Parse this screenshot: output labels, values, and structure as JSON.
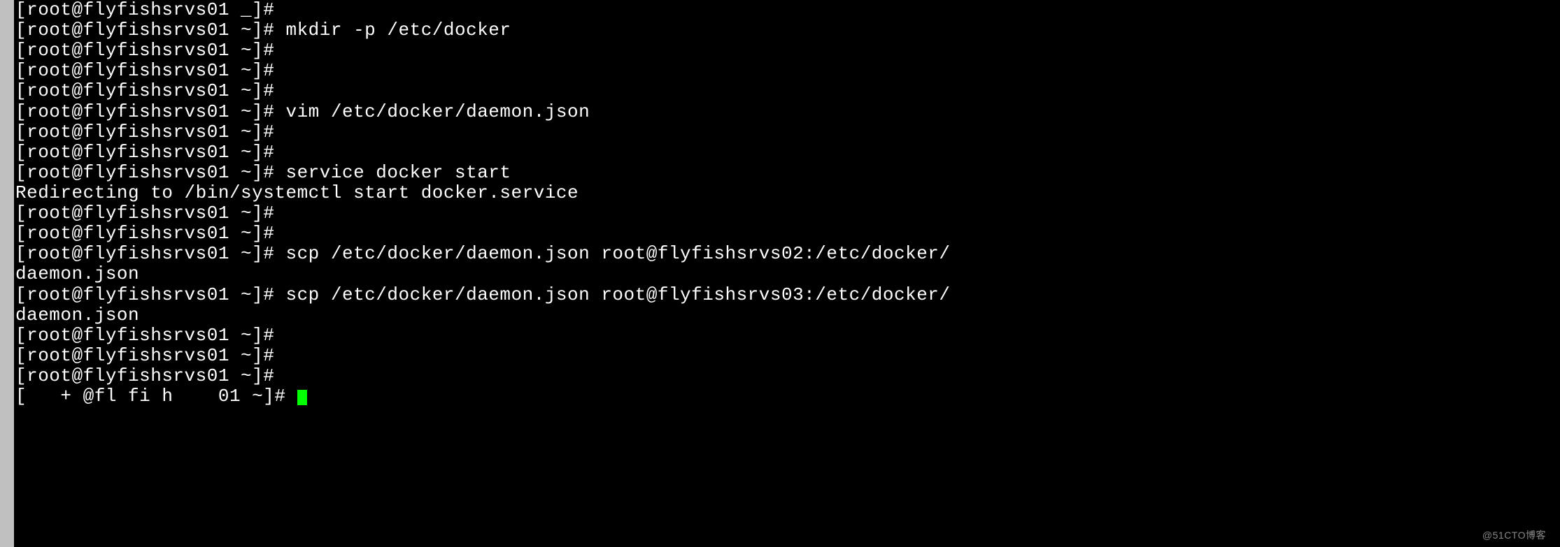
{
  "terminal": {
    "lines": [
      "[root@flyfishsrvs01 _]# ",
      "[root@flyfishsrvs01 ~]# mkdir -p /etc/docker",
      "[root@flyfishsrvs01 ~]# ",
      "[root@flyfishsrvs01 ~]# ",
      "[root@flyfishsrvs01 ~]# ",
      "[root@flyfishsrvs01 ~]# vim /etc/docker/daemon.json",
      "[root@flyfishsrvs01 ~]# ",
      "[root@flyfishsrvs01 ~]# ",
      "[root@flyfishsrvs01 ~]# service docker start",
      "Redirecting to /bin/systemctl start docker.service",
      "[root@flyfishsrvs01 ~]# ",
      "[root@flyfishsrvs01 ~]# ",
      "[root@flyfishsrvs01 ~]# scp /etc/docker/daemon.json root@flyfishsrvs02:/etc/docker/",
      "daemon.json",
      "[root@flyfishsrvs01 ~]# scp /etc/docker/daemon.json root@flyfishsrvs03:/etc/docker/",
      "daemon.json",
      "[root@flyfishsrvs01 ~]# ",
      "[root@flyfishsrvs01 ~]# ",
      "[root@flyfishsrvs01 ~]# "
    ],
    "current_prompt_partial": "[   + @fl fi h    01 ~]# ",
    "cursor_visible": true
  },
  "watermark": "@51CTO博客"
}
